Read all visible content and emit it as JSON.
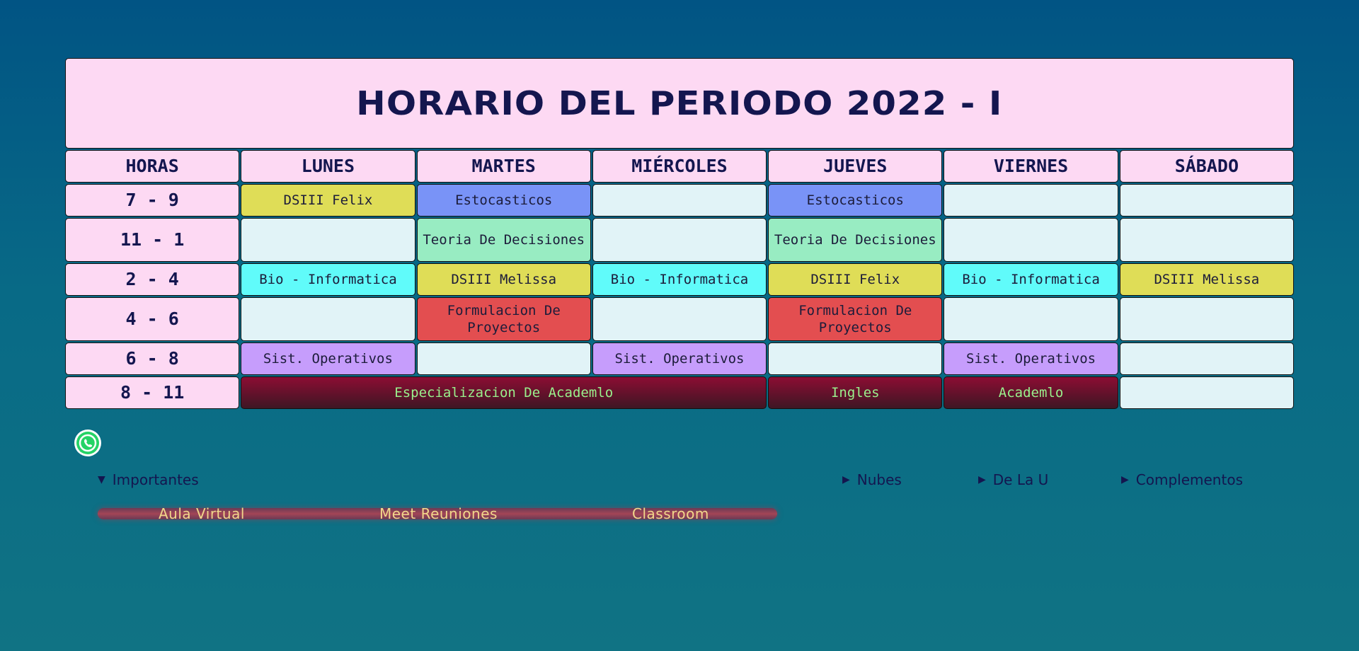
{
  "title": "HORARIO DEL PERIODO 2022 - I",
  "headers": [
    "HORAS",
    "LUNES",
    "MARTES",
    "MIÉRCOLES",
    "JUEVES",
    "VIERNES",
    "SÁBADO"
  ],
  "hours": [
    "7 - 9",
    "11 - 1",
    "2 - 4",
    "4 - 6",
    "6 - 8",
    "8 - 11"
  ],
  "classes": {
    "r1": {
      "lun": "DSIII Felix",
      "mar": "Estocasticos",
      "jue": "Estocasticos"
    },
    "r2": {
      "mar": "Teoria De Decisiones",
      "jue": "Teoria De Decisiones"
    },
    "r3": {
      "lun": "Bio - Informatica",
      "mar": "DSIII Melissa",
      "mie": "Bio - Informatica",
      "jue": "DSIII Felix",
      "vie": "Bio - Informatica",
      "sab": "DSIII Melissa"
    },
    "r4": {
      "mar": "Formulacion De Proyectos",
      "jue": "Formulacion De Proyectos"
    },
    "r5": {
      "lun": "Sist. Operativos",
      "mie": "Sist. Operativos",
      "vie": "Sist. Operativos"
    },
    "r6": {
      "lun_mie": "Especializacion De Academlo",
      "jue": "Ingles",
      "vie": "Academlo"
    }
  },
  "colors": {
    "yellow": "#dfdd57",
    "blue": "#7993f7",
    "green": "#98ecc2",
    "cyan": "#60fbfa",
    "red": "#e34e50",
    "purple": "#c69dfc",
    "empty": "#e1f3f7",
    "header": "#fdd9f3",
    "dark_red": "#8c0d33",
    "dark_text": "#9af08c",
    "link_text": "#f1d78b"
  },
  "footer": {
    "whatsapp_icon": "whatsapp-icon",
    "importantes": "Importantes",
    "nubes": "Nubes",
    "de_la_u": "De La U",
    "complementos": "Complementos",
    "links": {
      "aula": "Aula Virtual",
      "meet": "Meet Reuniones",
      "classroom": "Classroom"
    }
  }
}
